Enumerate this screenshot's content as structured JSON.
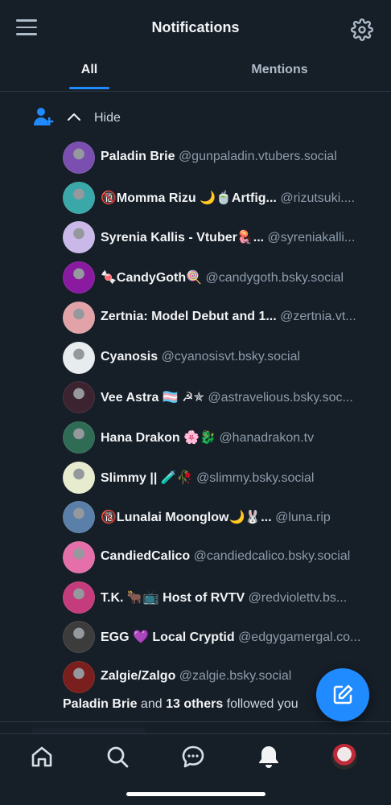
{
  "header": {
    "title": "Notifications"
  },
  "tabs": [
    {
      "label": "All"
    },
    {
      "label": "Mentions"
    }
  ],
  "group": {
    "hide_label": "Hide",
    "followers": [
      {
        "name": "Paladin Brie",
        "handle": "@gunpaladin.vtubers.social",
        "avatar_color": "#7a4fb0"
      },
      {
        "name": "🔞Momma Rizu 🌙🍵Artfig...",
        "handle": "@rizutsuki....",
        "avatar_color": "#3aa7a8"
      },
      {
        "name": "Syrenia Kallis - Vtuber🪼...",
        "handle": "@syreniakalli...",
        "avatar_color": "#c9b8e8"
      },
      {
        "name": "🍬CandyGoth🍭",
        "handle": "@candygoth.bsky.social",
        "avatar_color": "#8a1aa0"
      },
      {
        "name": "Zertnia: Model Debut and 1...",
        "handle": "@zertnia.vt...",
        "avatar_color": "#e2a3a8"
      },
      {
        "name": "Cyanosis",
        "handle": "@cyanosisvt.bsky.social",
        "avatar_color": "#e7ecee"
      },
      {
        "name": "Vee Astra 🏳️‍⚧️ ☭✯",
        "handle": "@astravelious.bsky.soc...",
        "avatar_color": "#3b2330"
      },
      {
        "name": "Hana Drakon 🌸🐉",
        "handle": "@hanadrakon.tv",
        "avatar_color": "#2f6b55"
      },
      {
        "name": "Slimmy || 🧪🥀",
        "handle": "@slimmy.bsky.social",
        "avatar_color": "#e8eccf"
      },
      {
        "name": "🔞Lunalai Moonglow🌙🐰...",
        "handle": "@luna.rip",
        "avatar_color": "#5a7fa8"
      },
      {
        "name": "CandiedCalico",
        "handle": "@candiedcalico.bsky.social",
        "avatar_color": "#e46fa9"
      },
      {
        "name": "T.K. 🐂📺 Host of RVTV",
        "handle": "@redviolettv.bs...",
        "avatar_color": "#c43c7c"
      },
      {
        "name": "EGG 💜 Local Cryptid",
        "handle": "@edgygamergal.co...",
        "avatar_color": "#3c3c3c"
      },
      {
        "name": "Zalgie/Zalgo",
        "handle": "@zalgie.bsky.social",
        "avatar_color": "#7b1e1e"
      }
    ],
    "summary": {
      "first_name": "Paladin Brie",
      "and": " and ",
      "others": "13 others",
      "action": " followed you"
    }
  },
  "colors": {
    "accent": "#208bfe",
    "background": "#161e27",
    "muted_text": "#8d9cac"
  },
  "nav": {
    "items": [
      {
        "icon": "home-icon"
      },
      {
        "icon": "search-icon"
      },
      {
        "icon": "chat-icon"
      },
      {
        "icon": "bell-icon",
        "active": true
      },
      {
        "icon": "profile-avatar"
      }
    ]
  }
}
